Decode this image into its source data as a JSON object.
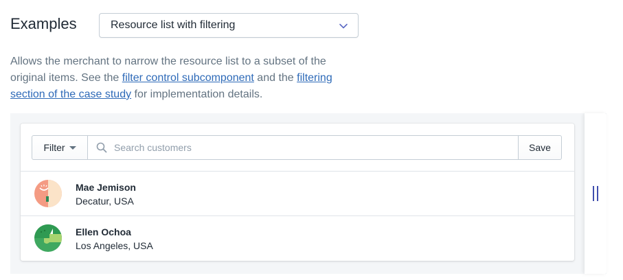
{
  "header": {
    "title": "Examples",
    "select_value": "Resource list with filtering"
  },
  "description": {
    "text_1": "Allows the merchant to narrow the resource list to a subset of the original items. See the ",
    "link_1": "filter control subcomponent",
    "text_2": " and the ",
    "link_2": "filtering section of the case study",
    "text_3": " for implementation details."
  },
  "filter_bar": {
    "filter_label": "Filter",
    "search_placeholder": "Search customers",
    "save_label": "Save"
  },
  "customers": [
    {
      "name": "Mae Jemison",
      "location": "Decatur, USA"
    },
    {
      "name": "Ellen Ochoa",
      "location": "Los Angeles, USA"
    }
  ],
  "colors": {
    "link": "#2e6ab8",
    "handle": "#3f4eae",
    "frame_bg": "#f4f6f8"
  }
}
